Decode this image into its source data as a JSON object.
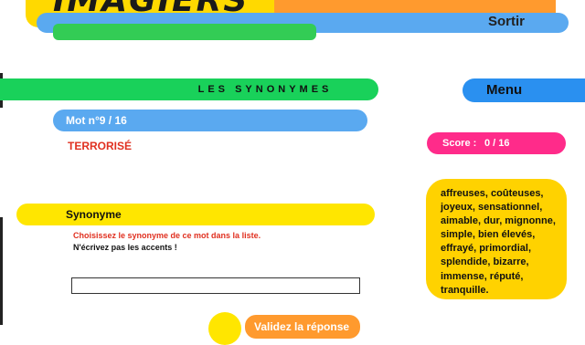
{
  "header": {
    "logo_text": "IMAGIERS",
    "exit_label": "Sortir"
  },
  "exercise": {
    "title": "LES SYNONYMES",
    "word_counter": "Mot n°9 / 16",
    "word": "TERRORISÉ",
    "section_title": "Synonyme",
    "instruction_1": "Choisissez le synonyme de ce mot dans la liste.",
    "instruction_2": "N'écrivez pas les accents !",
    "answer_value": "",
    "submit_label": "Validez la réponse"
  },
  "sidebar": {
    "menu_label": "Menu",
    "score_label": "Score :",
    "score_value": "0 / 16",
    "word_list": "affreuses, coûteuses, joyeux, sensationnel, aimable, dur, mignonne, simple, bien élevés, effrayé, primordial, splendide, bizarre, immense, réputé, tranquille."
  },
  "colors": {
    "yellow": "#ffd900",
    "orange": "#ff9a2e",
    "blue": "#5aa9f0",
    "green": "#19d15a",
    "pink": "#ff2b8a",
    "red_text": "#e03020"
  }
}
